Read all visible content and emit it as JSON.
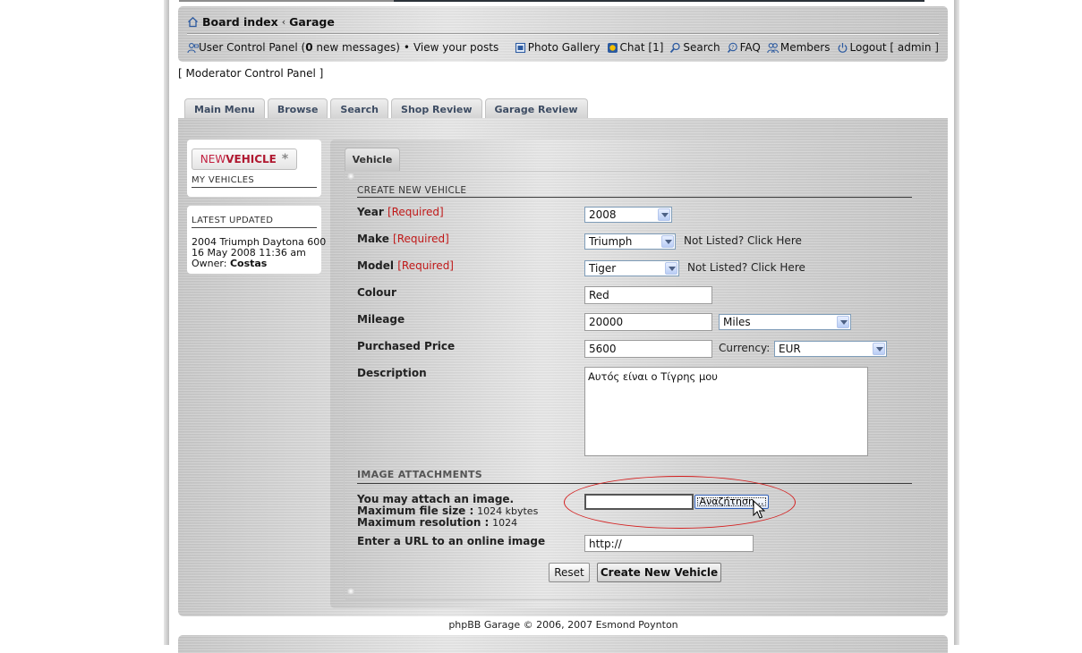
{
  "breadcrumb": {
    "home": "Board index",
    "separator": "‹",
    "current": "Garage"
  },
  "usernav": {
    "ucp_prefix": "User Control Panel (",
    "new_messages_count": "0",
    "ucp_suffix": " new messages)",
    "bullet": "•",
    "view_posts": "View your posts"
  },
  "toplinks": {
    "photo_gallery": "Photo Gallery",
    "chat": "Chat [1]",
    "search": "Search",
    "faq": "FAQ",
    "members": "Members",
    "logout": "Logout [ admin ]"
  },
  "moderator_panel": "[ Moderator Control Panel ]",
  "tabs": [
    "Main Menu",
    "Browse",
    "Search",
    "Shop Review",
    "Garage Review"
  ],
  "sidebar": {
    "new_vehicle_a": "NEW",
    "new_vehicle_b": "VEHICLE",
    "new_vehicle_star": "*",
    "my_vehicles": "MY VEHICLES",
    "latest_updated_title": "LATEST UPDATED",
    "latest": {
      "vehicle": "2004 Triumph Daytona 600",
      "date": "16 May 2008 11:36 am",
      "owner_label": "Owner:",
      "owner": "Costas"
    }
  },
  "form": {
    "tab": "Vehicle",
    "section_title": "CREATE NEW VEHICLE",
    "required": "[Required]",
    "year_label": "Year",
    "year_value": "2008",
    "make_label": "Make",
    "make_value": "Triumph",
    "model_label": "Model",
    "model_value": "Tiger",
    "not_listed": "Not Listed? Click Here",
    "colour_label": "Colour",
    "colour_value": "Red",
    "mileage_label": "Mileage",
    "mileage_value": "20000",
    "mileage_unit": "Miles",
    "price_label": "Purchased Price",
    "price_value": "5600",
    "currency_label": "Currency:",
    "currency_value": "EUR",
    "description_label": "Description",
    "description_value": "Αυτός είναι ο Τίγρης μου",
    "attachments_title": "IMAGE ATTACHMENTS",
    "attach_line1": "You may attach an image.",
    "max_size_label": "Maximum file size :",
    "max_size_value": "1024 kbytes",
    "max_res_label": "Maximum resolution :",
    "max_res_value": "1024",
    "file_value": "",
    "browse_button": "Αναζήτηση...",
    "url_label": "Enter a URL to an online image",
    "url_value": "http://",
    "reset_button": "Reset",
    "submit_button": "Create New Vehicle"
  },
  "footer": "phpBB Garage © 2006, 2007 Esmond Poynton",
  "colors": {
    "required": "#c01818",
    "annotation_ellipse": "#d42020",
    "tab_text": "#3d4c63"
  }
}
